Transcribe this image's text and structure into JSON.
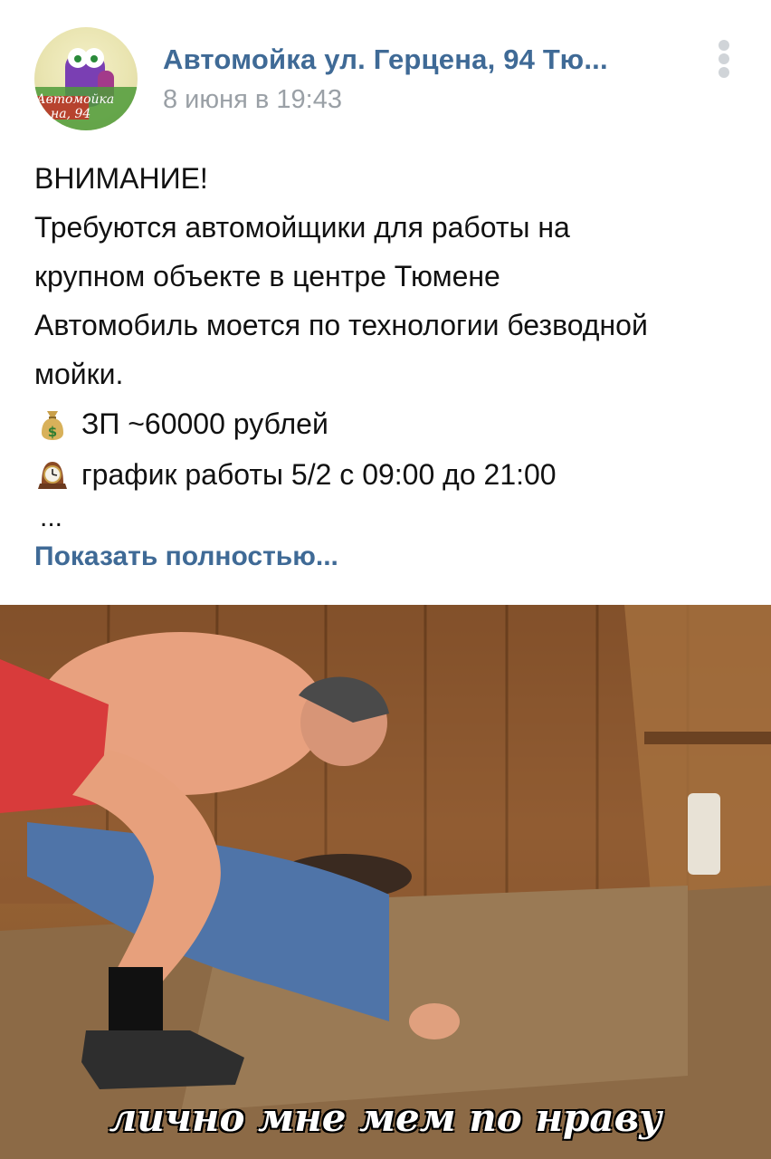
{
  "post": {
    "author": "Автомойка ул. Герцена, 94 Тю...",
    "date": "8 июня в 19:43",
    "avatar_text": [
      "Автомойка",
      "на, 94"
    ],
    "lines": [
      "ВНИМАНИЕ!",
      "Требуются автомойщики для работы на",
      "крупном объекте в центре Тюмене",
      "Автомобиль моется по технологии безводной",
      "мойки."
    ],
    "salary": "ЗП ~60000 рублей",
    "schedule": "график работы 5/2 с 09:00 до 21:00",
    "ellipsis": "...",
    "show_more": "Показать полностью...",
    "image_caption": "лично мне мем по нраву",
    "icons": {
      "salary": "money-bag-icon",
      "schedule": "clock-icon",
      "menu": "more-vertical-icon"
    }
  }
}
